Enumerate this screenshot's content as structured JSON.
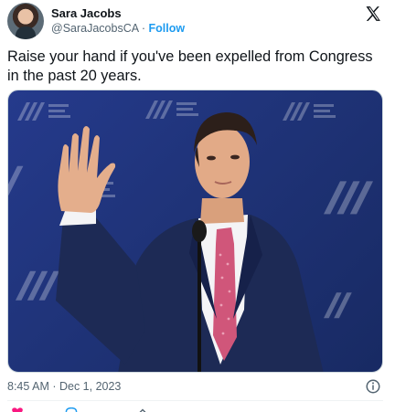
{
  "tweet": {
    "author_name": "Sara Jacobs",
    "author_handle": "@SaraJacobsCA",
    "separator": "·",
    "follow_label": "Follow",
    "text": "Raise your hand if you've been expelled from Congress in the past 20 years.",
    "timestamp": "8:45 AM · Dec 1, 2023"
  },
  "icons": {
    "platform_logo": "x-logo-icon",
    "info": "info-icon",
    "like": "heart-icon",
    "reply": "reply-icon",
    "share": "share-icon"
  },
  "colors": {
    "accent": "#1d9bf0",
    "like": "#f91880",
    "text_primary": "#0f1419",
    "text_secondary": "#536471"
  }
}
